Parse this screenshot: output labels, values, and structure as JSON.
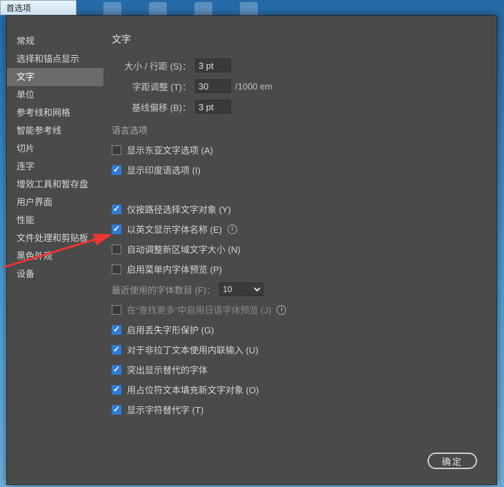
{
  "window": {
    "title": "首选项"
  },
  "sidebar": {
    "items": [
      {
        "label": "常规"
      },
      {
        "label": "选择和锚点显示"
      },
      {
        "label": "文字",
        "selected": true
      },
      {
        "label": "单位"
      },
      {
        "label": "参考线和网格"
      },
      {
        "label": "智能参考线"
      },
      {
        "label": "切片"
      },
      {
        "label": "连字"
      },
      {
        "label": "增效工具和暂存盘"
      },
      {
        "label": "用户界面"
      },
      {
        "label": "性能"
      },
      {
        "label": "文件处理和剪贴板"
      },
      {
        "label": "黑色外观"
      },
      {
        "label": "设备"
      }
    ]
  },
  "panel": {
    "title": "文字",
    "size_leading_label": "大小 / 行距 (S)：",
    "size_leading_value": "3 pt",
    "tracking_label": "字距调整 (T)：",
    "tracking_value": "30",
    "tracking_unit": "/1000 em",
    "baseline_label": "基线偏移 (B)：",
    "baseline_value": "3 pt",
    "lang_group": "语言选项",
    "opts": {
      "east_asian": {
        "label": "显示东亚文字选项 (A)",
        "checked": false
      },
      "indic": {
        "label": "显示印度语选项 (I)",
        "checked": true
      },
      "path_only": {
        "label": "仅按路径选择文字对象 (Y)",
        "checked": true
      },
      "english_names": {
        "label": "以英文显示字体名称 (E)",
        "checked": true,
        "info": true
      },
      "auto_resize": {
        "label": "自动调整新区域文字大小 (N)",
        "checked": false
      },
      "menu_preview": {
        "label": "启用菜单内字体预览 (P)",
        "checked": false
      },
      "recent_fonts_label": "最近使用的字体数目 (F)：",
      "recent_fonts_value": "10",
      "jp_preview": {
        "label": "在“查找更多”中启用日语字体预览 (J)",
        "checked": false,
        "info": true,
        "disabled": true
      },
      "missing_glyph": {
        "label": "启用丢失字形保护 (G)",
        "checked": true
      },
      "inline_input": {
        "label": "对于非拉丁文本使用内联输入 (U)",
        "checked": true
      },
      "highlight_alt": {
        "label": "突出显示替代的字体",
        "checked": true
      },
      "placeholder_fill": {
        "label": "用占位符文本填充新文字对象 (O)",
        "checked": true
      },
      "show_alt_glyph": {
        "label": "显示字符替代字 (T)",
        "checked": true
      }
    }
  },
  "buttons": {
    "ok": "确定"
  }
}
